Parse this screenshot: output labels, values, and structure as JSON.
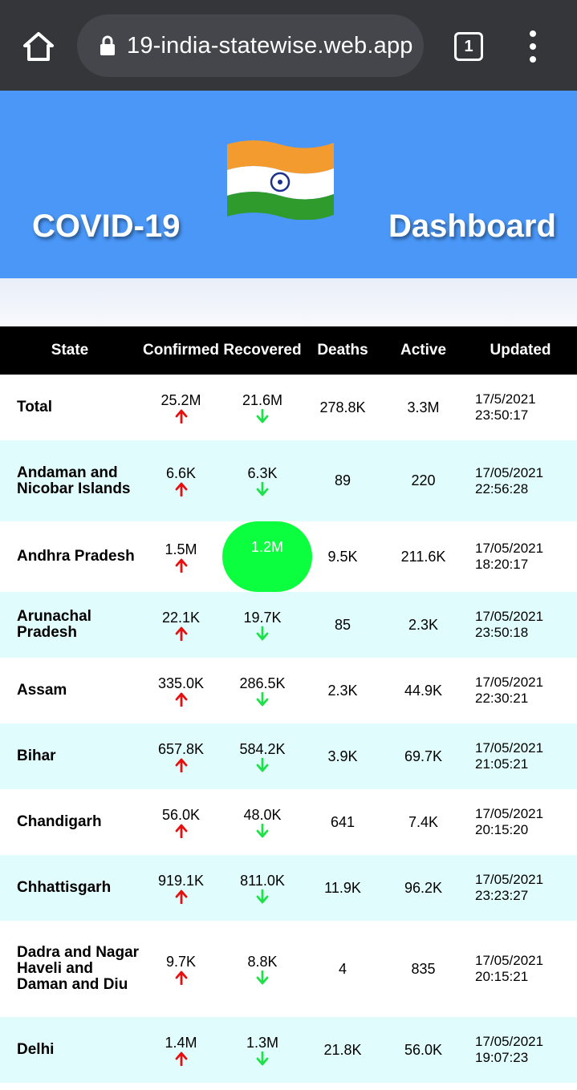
{
  "browser": {
    "url": "19-india-statewise.web.app",
    "tab_count": "1"
  },
  "header": {
    "left_title": "COVID-19",
    "right_title": "Dashboard",
    "flag_icon": "india-flag-icon"
  },
  "colors": {
    "banner": "#4a97f7",
    "up_arrow": "#e8100f",
    "down_arrow": "#1ee14a",
    "row_alt": "#e0fcfd",
    "highlight": "#0cff3f"
  },
  "table": {
    "columns": [
      "State",
      "Confirmed",
      "Recovered",
      "Deaths",
      "Active",
      "Updated"
    ],
    "rows": [
      {
        "state": "Total",
        "confirmed": "25.2M",
        "recovered": "21.6M",
        "deaths": "278.8K",
        "active": "3.3M",
        "updated_date": "17/5/2021",
        "updated_time": "23:50:17"
      },
      {
        "state": "Andaman and Nicobar Islands",
        "confirmed": "6.6K",
        "recovered": "6.3K",
        "deaths": "89",
        "active": "220",
        "updated_date": "17/05/2021",
        "updated_time": "22:56:28"
      },
      {
        "state": "Andhra Pradesh",
        "confirmed": "1.5M",
        "recovered": "1.2M",
        "deaths": "9.5K",
        "active": "211.6K",
        "updated_date": "17/05/2021",
        "updated_time": "18:20:17"
      },
      {
        "state": "Arunachal Pradesh",
        "confirmed": "22.1K",
        "recovered": "19.7K",
        "deaths": "85",
        "active": "2.3K",
        "updated_date": "17/05/2021",
        "updated_time": "23:50:18"
      },
      {
        "state": "Assam",
        "confirmed": "335.0K",
        "recovered": "286.5K",
        "deaths": "2.3K",
        "active": "44.9K",
        "updated_date": "17/05/2021",
        "updated_time": "22:30:21"
      },
      {
        "state": "Bihar",
        "confirmed": "657.8K",
        "recovered": "584.2K",
        "deaths": "3.9K",
        "active": "69.7K",
        "updated_date": "17/05/2021",
        "updated_time": "21:05:21"
      },
      {
        "state": "Chandigarh",
        "confirmed": "56.0K",
        "recovered": "48.0K",
        "deaths": "641",
        "active": "7.4K",
        "updated_date": "17/05/2021",
        "updated_time": "20:15:20"
      },
      {
        "state": "Chhattisgarh",
        "confirmed": "919.1K",
        "recovered": "811.0K",
        "deaths": "11.9K",
        "active": "96.2K",
        "updated_date": "17/05/2021",
        "updated_time": "23:23:27"
      },
      {
        "state": "Dadra and Nagar Haveli and Daman and Diu",
        "confirmed": "9.7K",
        "recovered": "8.8K",
        "deaths": "4",
        "active": "835",
        "updated_date": "17/05/2021",
        "updated_time": "20:15:21"
      },
      {
        "state": "Delhi",
        "confirmed": "1.4M",
        "recovered": "1.3M",
        "deaths": "21.8K",
        "active": "56.0K",
        "updated_date": "17/05/2021",
        "updated_time": "19:07:23"
      }
    ]
  }
}
